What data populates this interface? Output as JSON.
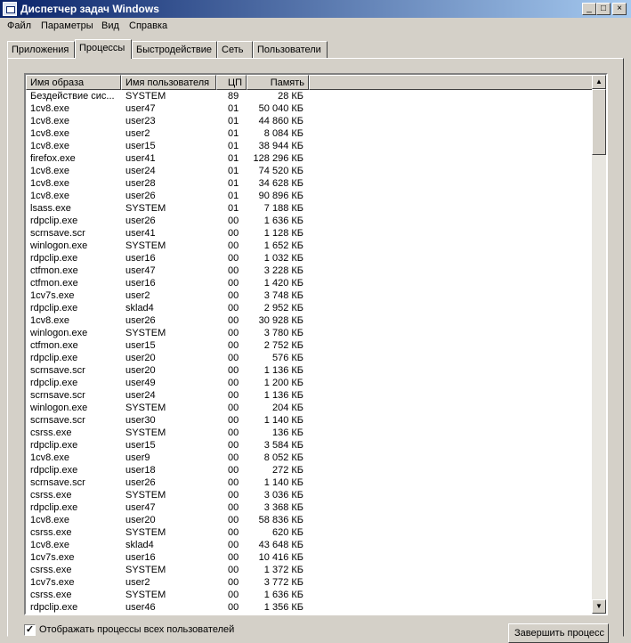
{
  "window": {
    "title": "Диспетчер задач Windows",
    "buttons": {
      "minimize": "_",
      "maximize": "□",
      "close": "×"
    }
  },
  "menu": [
    "Файл",
    "Параметры",
    "Вид",
    "Справка"
  ],
  "tabs": [
    "Приложения",
    "Процессы",
    "Быстродействие",
    "Сеть",
    "Пользователи"
  ],
  "active_tab": "Процессы",
  "columns": [
    "Имя образа",
    "Имя пользователя",
    "ЦП",
    "Память"
  ],
  "processes": [
    [
      "Бездействие сис...",
      "SYSTEM",
      "89",
      "28 КБ"
    ],
    [
      "1cv8.exe",
      "user47",
      "01",
      "50 040 КБ"
    ],
    [
      "1cv8.exe",
      "user23",
      "01",
      "44 860 КБ"
    ],
    [
      "1cv8.exe",
      "user2",
      "01",
      "8 084 КБ"
    ],
    [
      "1cv8.exe",
      "user15",
      "01",
      "38 944 КБ"
    ],
    [
      "firefox.exe",
      "user41",
      "01",
      "128 296 КБ"
    ],
    [
      "1cv8.exe",
      "user24",
      "01",
      "74 520 КБ"
    ],
    [
      "1cv8.exe",
      "user28",
      "01",
      "34 628 КБ"
    ],
    [
      "1cv8.exe",
      "user26",
      "01",
      "90 896 КБ"
    ],
    [
      "lsass.exe",
      "SYSTEM",
      "01",
      "7 188 КБ"
    ],
    [
      "rdpclip.exe",
      "user26",
      "00",
      "1 636 КБ"
    ],
    [
      "scrnsave.scr",
      "user41",
      "00",
      "1 128 КБ"
    ],
    [
      "winlogon.exe",
      "SYSTEM",
      "00",
      "1 652 КБ"
    ],
    [
      "rdpclip.exe",
      "user16",
      "00",
      "1 032 КБ"
    ],
    [
      "ctfmon.exe",
      "user47",
      "00",
      "3 228 КБ"
    ],
    [
      "ctfmon.exe",
      "user16",
      "00",
      "1 420 КБ"
    ],
    [
      "1cv7s.exe",
      "user2",
      "00",
      "3 748 КБ"
    ],
    [
      "rdpclip.exe",
      "sklad4",
      "00",
      "2 952 КБ"
    ],
    [
      "1cv8.exe",
      "user26",
      "00",
      "30 928 КБ"
    ],
    [
      "winlogon.exe",
      "SYSTEM",
      "00",
      "3 780 КБ"
    ],
    [
      "ctfmon.exe",
      "user15",
      "00",
      "2 752 КБ"
    ],
    [
      "rdpclip.exe",
      "user20",
      "00",
      "576 КБ"
    ],
    [
      "scrnsave.scr",
      "user20",
      "00",
      "1 136 КБ"
    ],
    [
      "rdpclip.exe",
      "user49",
      "00",
      "1 200 КБ"
    ],
    [
      "scrnsave.scr",
      "user24",
      "00",
      "1 136 КБ"
    ],
    [
      "winlogon.exe",
      "SYSTEM",
      "00",
      "204 КБ"
    ],
    [
      "scrnsave.scr",
      "user30",
      "00",
      "1 140 КБ"
    ],
    [
      "csrss.exe",
      "SYSTEM",
      "00",
      "136 КБ"
    ],
    [
      "rdpclip.exe",
      "user15",
      "00",
      "3 584 КБ"
    ],
    [
      "1cv8.exe",
      "user9",
      "00",
      "8 052 КБ"
    ],
    [
      "rdpclip.exe",
      "user18",
      "00",
      "272 КБ"
    ],
    [
      "scrnsave.scr",
      "user26",
      "00",
      "1 140 КБ"
    ],
    [
      "csrss.exe",
      "SYSTEM",
      "00",
      "3 036 КБ"
    ],
    [
      "rdpclip.exe",
      "user47",
      "00",
      "3 368 КБ"
    ],
    [
      "1cv8.exe",
      "user20",
      "00",
      "58 836 КБ"
    ],
    [
      "csrss.exe",
      "SYSTEM",
      "00",
      "620 КБ"
    ],
    [
      "1cv8.exe",
      "sklad4",
      "00",
      "43 648 КБ"
    ],
    [
      "1cv7s.exe",
      "user16",
      "00",
      "10 416 КБ"
    ],
    [
      "csrss.exe",
      "SYSTEM",
      "00",
      "1 372 КБ"
    ],
    [
      "1cv7s.exe",
      "user2",
      "00",
      "3 772 КБ"
    ],
    [
      "csrss.exe",
      "SYSTEM",
      "00",
      "1 636 КБ"
    ],
    [
      "rdpclip.exe",
      "user46",
      "00",
      "1 356 КБ"
    ]
  ],
  "show_all_users": {
    "label": "Отображать процессы всех пользователей",
    "checked": true
  },
  "end_process_label": "Завершить процесс"
}
